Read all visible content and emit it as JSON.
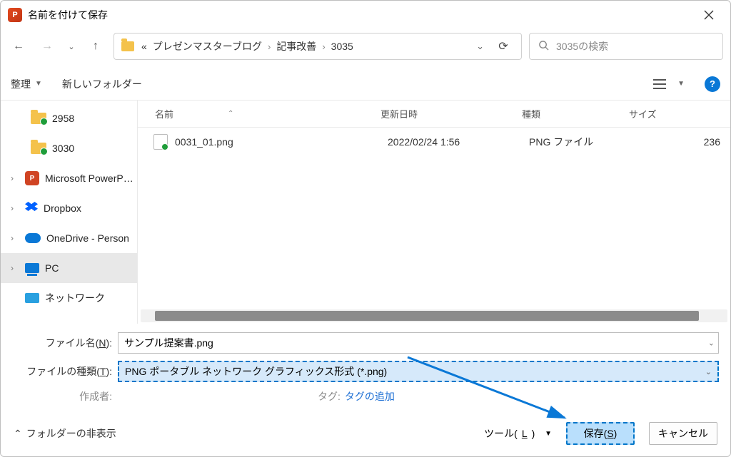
{
  "title": "名前を付けて保存",
  "breadcrumb": {
    "prefix": "«",
    "p1": "プレゼンマスターブログ",
    "p2": "記事改善",
    "p3": "3035"
  },
  "search": {
    "placeholder": "3035の検索"
  },
  "toolbar": {
    "organize": "整理",
    "newfolder": "新しいフォルダー"
  },
  "columns": {
    "name": "名前",
    "date": "更新日時",
    "type": "種類",
    "size": "サイズ"
  },
  "tree": {
    "i0": "2958",
    "i1": "3030",
    "i2": "Microsoft PowerP…",
    "i3": "Dropbox",
    "i4": "OneDrive - Person",
    "i5": "PC",
    "i6": "ネットワーク"
  },
  "files": {
    "r0": {
      "name": "0031_01.png",
      "date": "2022/02/24 1:56",
      "type": "PNG ファイル",
      "size": "236"
    }
  },
  "form": {
    "filename_label": "ファイル名(N):",
    "filename_value": "サンプル提案書.png",
    "filetype_label": "ファイルの種類(T):",
    "filetype_value": "PNG ポータブル ネットワーク グラフィックス形式 (*.png)",
    "author_label": "作成者:",
    "tag_label": "タグ:",
    "tag_link": "タグの追加"
  },
  "actions": {
    "hide_folders": "フォルダーの非表示",
    "tools": "ツール(L)",
    "save": "保存(S)",
    "cancel": "キャンセル"
  }
}
